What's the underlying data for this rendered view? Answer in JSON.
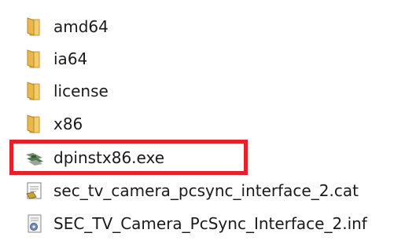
{
  "explorer": {
    "items": [
      {
        "label": "amd64",
        "icon": "folder-icon"
      },
      {
        "label": "ia64",
        "icon": "folder-icon"
      },
      {
        "label": "license",
        "icon": "folder-icon"
      },
      {
        "label": "x86",
        "icon": "folder-icon"
      },
      {
        "label": "dpinstx86.exe",
        "icon": "driver-installer-icon"
      },
      {
        "label": "sec_tv_camera_pcsync_interface_2.cat",
        "icon": "security-catalog-icon"
      },
      {
        "label": "SEC_TV_Camera_PcSync_Interface_2.inf",
        "icon": "setup-information-icon"
      }
    ]
  },
  "colors": {
    "folder": "#e8b94a",
    "highlight_border": "#e3202c"
  }
}
